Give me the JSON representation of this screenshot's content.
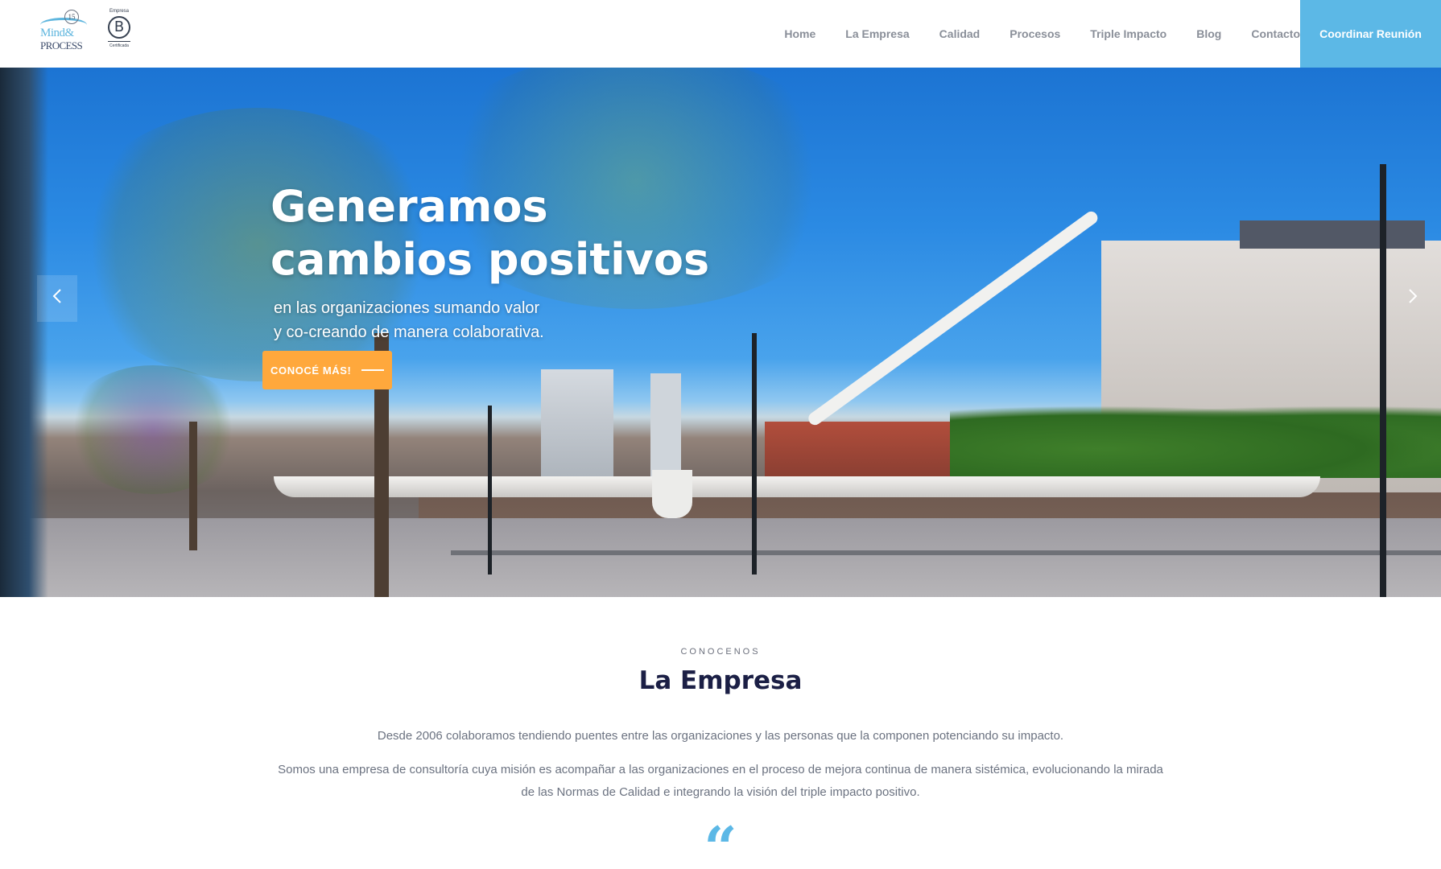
{
  "brand": {
    "logo_text_line1": "Mind&",
    "logo_text_line2": "PROCESS",
    "logo_badge_number": "15",
    "bcorp_top": "Empresa",
    "bcorp_letter": "B",
    "bcorp_bottom": "Certificada"
  },
  "nav": {
    "items": [
      {
        "label": "Home"
      },
      {
        "label": "La Empresa"
      },
      {
        "label": "Calidad"
      },
      {
        "label": "Procesos"
      },
      {
        "label": "Triple Impacto"
      },
      {
        "label": "Blog"
      },
      {
        "label": "Contacto"
      }
    ],
    "cta_label": "Coordinar Reunión"
  },
  "hero": {
    "headline_line1": "Generamos",
    "headline_line2": "cambios positivos",
    "sub_line1": "en las organizaciones sumando valor",
    "sub_line2": "y co-creando de manera colaborativa.",
    "button_label": "CONOCÉ MÁS!",
    "prev_icon": "chevron-left-icon",
    "next_icon": "chevron-right-icon"
  },
  "about": {
    "eyebrow": "CONOCENOS",
    "title": "La Empresa",
    "paragraph1": "Desde 2006 colaboramos tendiendo puentes entre las organizaciones y las personas que la componen potenciando su impacto.",
    "paragraph2": "Somos una empresa de consultoría cuya misión es acompañar a las organizaciones en el proceso de mejora continua de manera sistémica, evolucionando la mirada de las Normas de Calidad e integrando la visión del triple impacto positivo.",
    "quote_mark": "“"
  },
  "colors": {
    "accent_blue": "#5cb8e6",
    "cta_orange": "#ffa83c",
    "title_navy": "#1b1f45",
    "nav_text": "#8a8f99"
  }
}
